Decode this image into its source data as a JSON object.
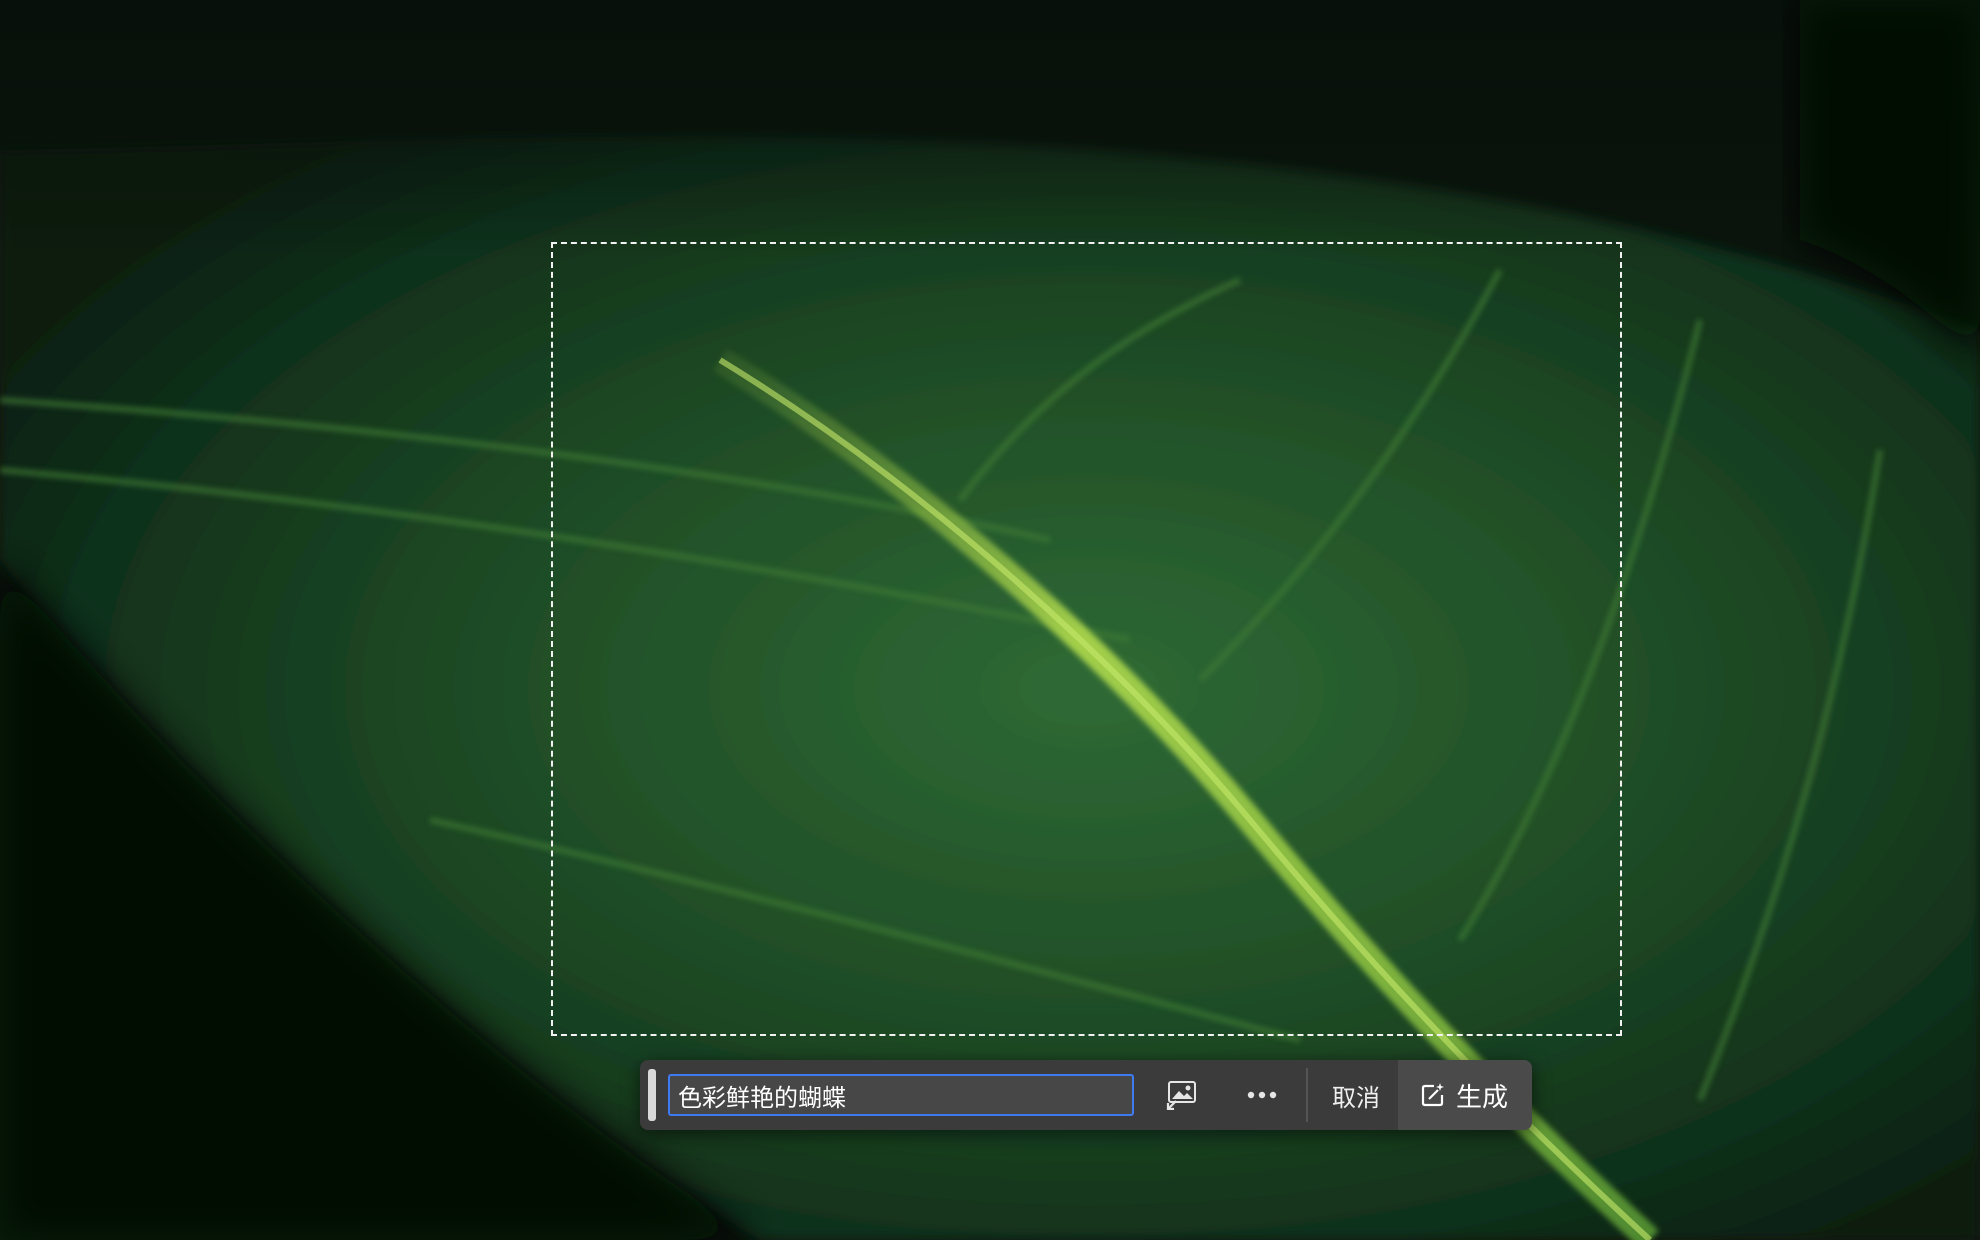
{
  "canvas": {
    "description_icon": "leaf-photo-background"
  },
  "selection": {
    "style": "marching-ants"
  },
  "contextual_taskbar": {
    "prompt_value": "色彩鲜艳的蝴蝶",
    "reference_image_icon": "reference-image-icon",
    "more_icon": "more-options-icon",
    "cancel_label": "取消",
    "generate_label": "生成",
    "generate_icon": "generate-icon",
    "accent_color": "#3d7bf3"
  }
}
